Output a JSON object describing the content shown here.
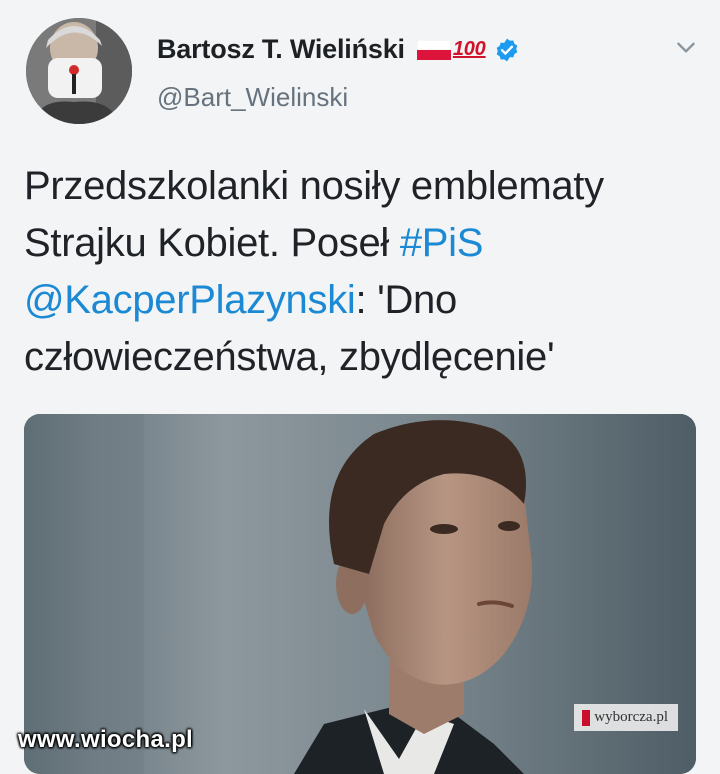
{
  "tweet": {
    "author_name": "Bartosz T. Wieliński",
    "hundred_emoji": "100",
    "handle": "@Bart_Wielinski",
    "text_parts": {
      "p1": "Przedszkolanki nosiły emblematy Strajku Kobiet. Poseł ",
      "hashtag": "#PiS",
      "mention": "@KacperPlazynski",
      "p2": ": 'Dno człowieczeństwa, zbydlęcenie'"
    },
    "media_source": "wyborcza.pl"
  },
  "watermark": "www.wiocha.pl",
  "icons": {
    "flag": "poland-flag-icon",
    "hundred": "hundred-points-icon",
    "verified": "verified-badge-icon",
    "chevron": "chevron-down-icon"
  },
  "colors": {
    "link": "#1b89d3",
    "verified": "#1d9bf0",
    "handle": "#66727d",
    "background": "#f3f4f5"
  }
}
